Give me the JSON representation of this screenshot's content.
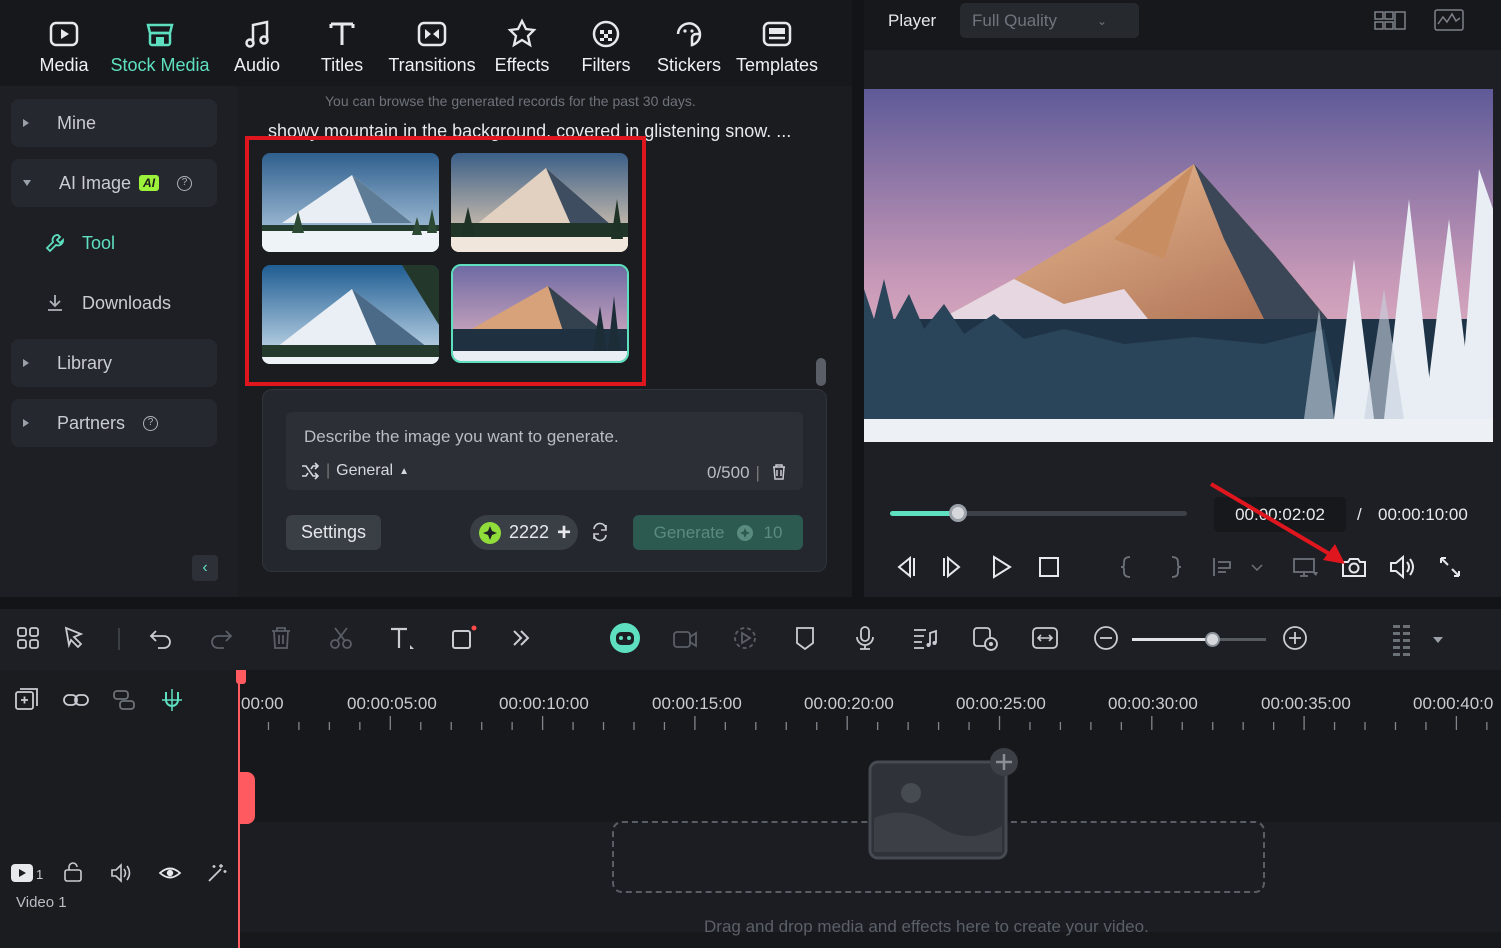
{
  "top_tabs": [
    {
      "label": "Media",
      "icon": "media-icon"
    },
    {
      "label": "Stock Media",
      "icon": "stock-media-icon",
      "active": true
    },
    {
      "label": "Audio",
      "icon": "music-note-icon"
    },
    {
      "label": "Titles",
      "icon": "titles-icon"
    },
    {
      "label": "Transitions",
      "icon": "transitions-icon"
    },
    {
      "label": "Effects",
      "icon": "effects-icon"
    },
    {
      "label": "Filters",
      "icon": "filters-icon"
    },
    {
      "label": "Stickers",
      "icon": "stickers-icon"
    },
    {
      "label": "Templates",
      "icon": "templates-icon"
    }
  ],
  "sidebar": {
    "mine": "Mine",
    "ai_image": "AI Image",
    "ai_badge": "AI",
    "tool": "Tool",
    "downloads": "Downloads",
    "library": "Library",
    "partners": "Partners"
  },
  "generator": {
    "records_note": "You can browse the generated records for the past 30 days.",
    "prompt_snippet": "showy mountain in the background, covered in glistening snow. ...",
    "placeholder": "Describe the image you want to generate.",
    "style": "General",
    "char_count": "0/500",
    "settings_label": "Settings",
    "credits": "2222",
    "generate_label": "Generate",
    "generate_cost": "10"
  },
  "player": {
    "label": "Player",
    "quality": "Full Quality",
    "current_time": "00:00:02:02",
    "separator": "/",
    "total_time": "00:00:10:00",
    "progress": 0.23
  },
  "timeline": {
    "timecodes": [
      "00:00",
      "00:00:05:00",
      "00:00:10:00",
      "00:00:15:00",
      "00:00:20:00",
      "00:00:25:00",
      "00:00:30:00",
      "00:00:35:00",
      "00:00:40:0"
    ],
    "track_number": "1",
    "track_name": "Video 1",
    "drop_hint": "Drag and drop media and effects here to create your video.",
    "zoom_level": 0.6
  },
  "colors": {
    "accent": "#5ee0c0",
    "highlight_box": "#e0161e",
    "annotation_arrow": "#e0161e",
    "playhead": "#ff5a5f",
    "ai_badge": "#9cf23a"
  }
}
